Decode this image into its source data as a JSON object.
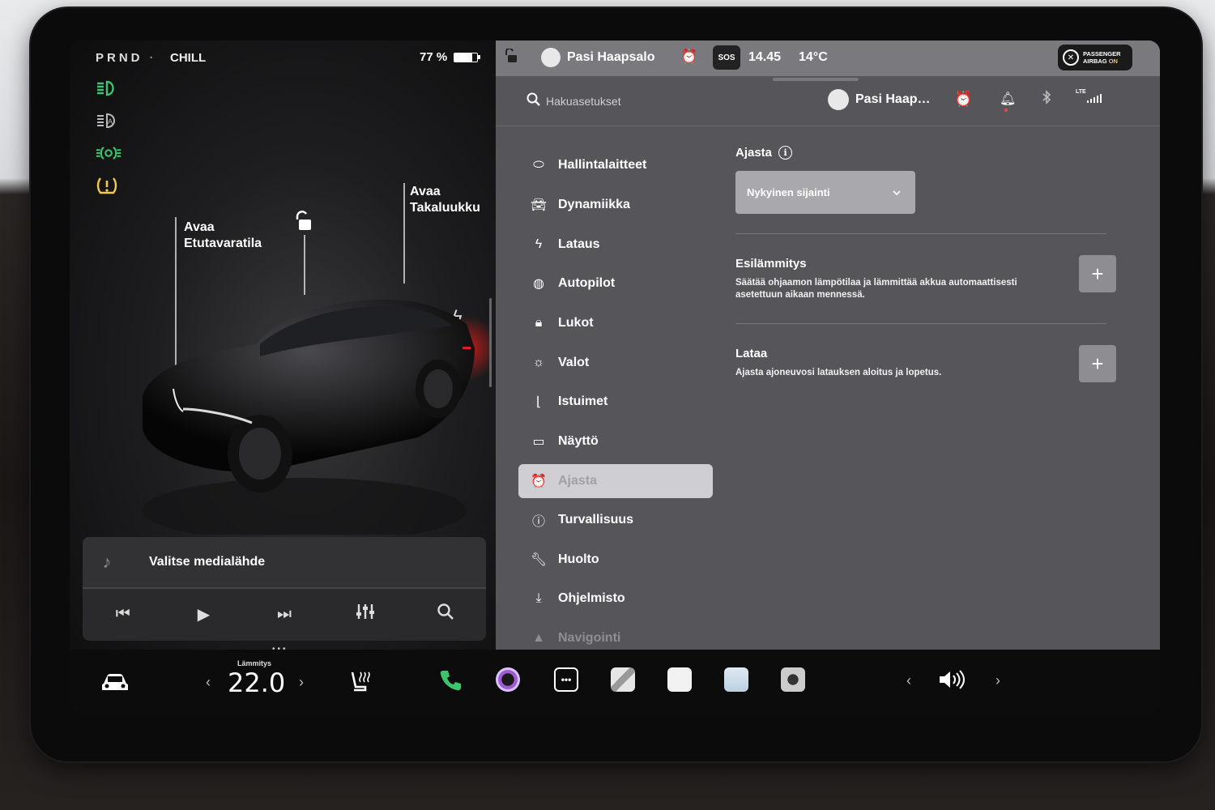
{
  "status": {
    "gears": "PRND",
    "drive_mode": "CHILL",
    "battery_percent": "77 %",
    "battery_fraction": 0.77
  },
  "car": {
    "frunk_label_line1": "Avaa",
    "frunk_label_line2": "Etutavaratila",
    "trunk_label_line1": "Avaa",
    "trunk_label_line2": "Takaluukku"
  },
  "media": {
    "source_label": "Valitse medialähde"
  },
  "topbar": {
    "user": "Pasi Haapsalo",
    "sos": "SOS",
    "time": "14.45",
    "temperature": "14°C",
    "airbag_line1": "PASSENGER",
    "airbag_line2": "AIRBAG",
    "airbag_state": "ON"
  },
  "settings_header": {
    "search_placeholder": "Hakuasetukset",
    "user_short": "Pasi Haap…",
    "lte": "LTE"
  },
  "nav": {
    "items": [
      {
        "label": "Hallintalaitteet",
        "icon": "toggle-icon"
      },
      {
        "label": "Dynamiikka",
        "icon": "car-icon"
      },
      {
        "label": "Lataus",
        "icon": "bolt-icon"
      },
      {
        "label": "Autopilot",
        "icon": "steering-wheel-icon"
      },
      {
        "label": "Lukot",
        "icon": "lock-icon"
      },
      {
        "label": "Valot",
        "icon": "sun-icon"
      },
      {
        "label": "Istuimet",
        "icon": "seat-icon"
      },
      {
        "label": "Näyttö",
        "icon": "display-icon"
      },
      {
        "label": "Ajasta",
        "icon": "alarm-clock-icon"
      },
      {
        "label": "Turvallisuus",
        "icon": "alert-circle-icon"
      },
      {
        "label": "Huolto",
        "icon": "wrench-icon"
      },
      {
        "label": "Ohjelmisto",
        "icon": "download-icon"
      },
      {
        "label": "Navigointi",
        "icon": "navigation-icon"
      }
    ],
    "active_index": 8
  },
  "schedule": {
    "title": "Ajasta",
    "location_selected": "Nykyinen sijainti",
    "preheat_title": "Esilämmitys",
    "preheat_desc": "Säätää ohjaamon lämpötilaa ja lämmittää akkua automaattisesti asetettuun aikaan mennessä.",
    "charge_title": "Lataa",
    "charge_desc": "Ajasta ajoneuvosi latauksen aloitus ja lopetus.",
    "plus": "+"
  },
  "dock": {
    "climate_caption": "Lämmitys",
    "climate_temp": "22.0"
  },
  "colors": {
    "accent_green": "#3ec46d",
    "accent_yellow": "#f2c94c",
    "panel_gray": "#56565a"
  }
}
